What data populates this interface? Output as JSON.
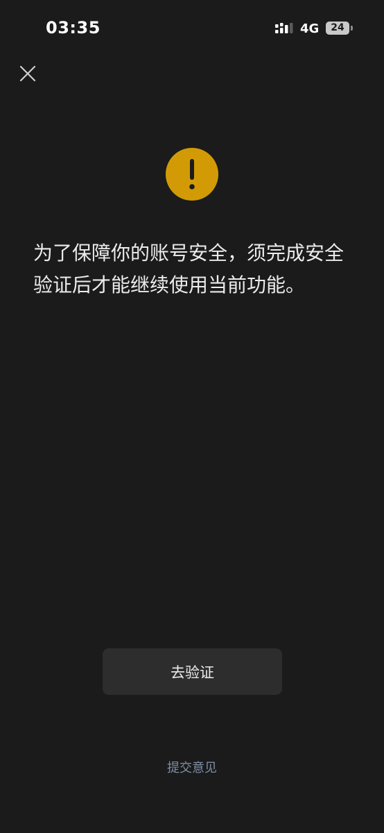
{
  "status_bar": {
    "time": "03:35",
    "network": "4G",
    "battery": "24"
  },
  "icons": {
    "close": "close-icon",
    "warning": "exclamation-icon",
    "signal": "signal-icon"
  },
  "colors": {
    "background": "#1b1b1b",
    "warning": "#d29b06",
    "button_background": "#2d2d2d",
    "link": "#7d8fa6"
  },
  "main": {
    "message": "为了保障你的账号安全，须完成安全验证后才能继续使用当前功能。",
    "verify_button_label": "去验证",
    "feedback_link_label": "提交意见"
  }
}
